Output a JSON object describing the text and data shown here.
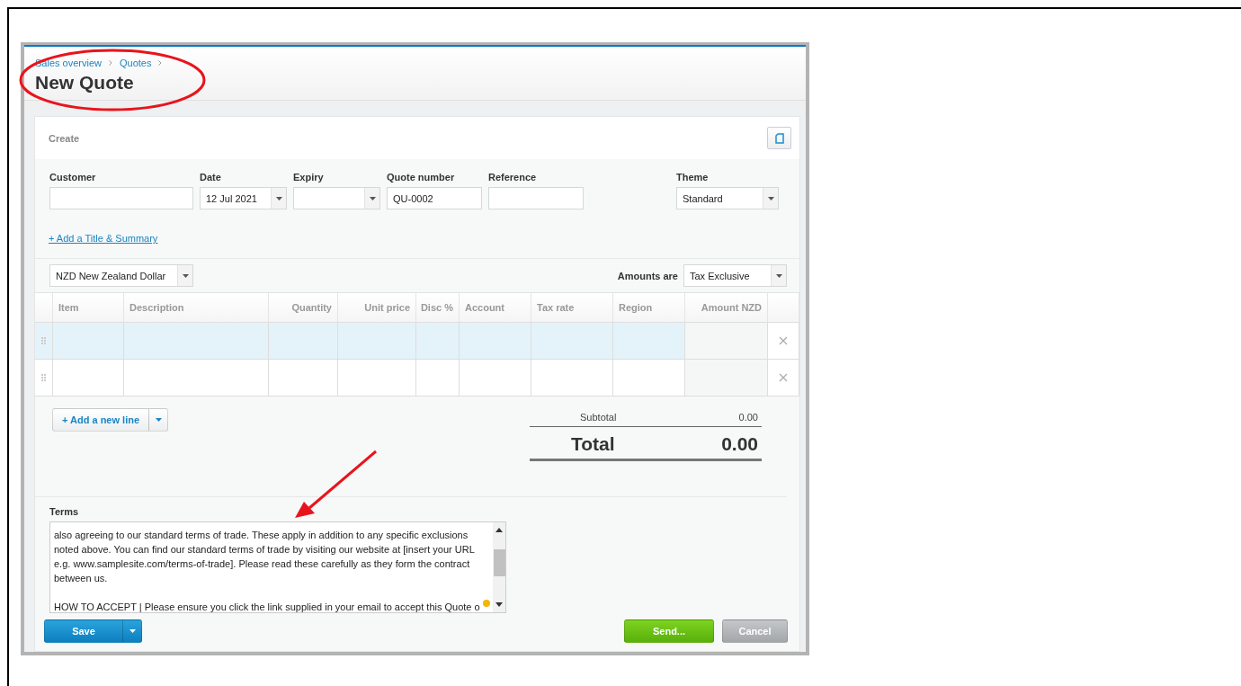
{
  "breadcrumbs": [
    "Sales overview",
    "Quotes"
  ],
  "page_title": "New Quote",
  "card_title": "Create",
  "fields": [
    {
      "label": "Customer",
      "kind": "text"
    },
    {
      "label": "Date",
      "value": "12 Jul 2021",
      "kind": "dropdown"
    },
    {
      "label": "Expiry",
      "kind": "dropdown"
    },
    {
      "label": "Quote number",
      "value": "QU-0002",
      "kind": "text"
    },
    {
      "label": "Reference",
      "kind": "text"
    },
    {
      "label": "Theme",
      "value": "Standard",
      "kind": "dropdown"
    }
  ],
  "add_title_link": "+ Add a Title & Summary",
  "currency": "NZD New Zealand Dollar",
  "amounts_label": "Amounts are",
  "amounts_value": "Tax Exclusive",
  "table": {
    "columns": [
      "Item",
      "Description",
      "Quantity",
      "Unit price",
      "Disc %",
      "Account",
      "Tax rate",
      "Region",
      "Amount NZD"
    ],
    "rows": [
      {
        "selected": true
      },
      {
        "selected": false
      }
    ]
  },
  "add_line_button": "+ Add a new line",
  "subtotal_label": "Subtotal",
  "subtotal_value": "0.00",
  "total_label": "Total",
  "total_value": "0.00",
  "terms_label": "Terms",
  "terms_paragraphs": [
    [
      "also agreeing to our standard terms of trade. These apply in addition to any specific exclusions",
      "noted above. You can find our standard terms of trade by visiting our website at [insert your URL",
      "e.g. www.samplesite.com/terms-of-trade]. Please read these carefully as they form the contract",
      "between us."
    ],
    [
      "HOW TO ACCEPT | Please ensure you click the link supplied in your email to accept this Quote o"
    ]
  ],
  "buttons": {
    "save": "Save",
    "send": "Send...",
    "cancel": "Cancel"
  }
}
